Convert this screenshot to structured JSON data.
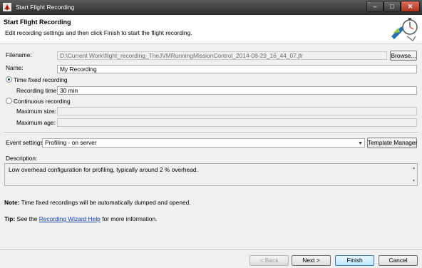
{
  "window": {
    "title": "Start Flight Recording",
    "minimize_label": "‒",
    "maximize_label": "□",
    "close_label": "✕"
  },
  "header": {
    "title": "Start Flight Recording",
    "description": "Edit recording settings and then click Finish to start the flight recording."
  },
  "filename": {
    "label": "Filename:",
    "value": "D:\\Current Work\\flight_recording_TheJVMRunningMissionControl_2014-08-29_16_44_07.jfr",
    "browse_label": "Browse..."
  },
  "name": {
    "label": "Name:",
    "value": "My Recording"
  },
  "time_fixed": {
    "label": "Time fixed recording",
    "selected": true,
    "recording_time_label": "Recording time:",
    "recording_time_value": "30 min"
  },
  "continuous": {
    "label": "Continuous recording",
    "selected": false,
    "max_size_label": "Maximum size:",
    "max_size_value": "",
    "max_age_label": "Maximum age:",
    "max_age_value": ""
  },
  "event_settings": {
    "label": "Event settings:",
    "selected": "Profiling - on server",
    "template_manager_label": "Template Manager"
  },
  "description": {
    "label": "Description:",
    "text": "Low overhead configuration for profiling, typically around 2 % overhead."
  },
  "note": {
    "prefix": "Note:",
    "text": "Time fixed recordings will be automatically dumped and opened."
  },
  "tip": {
    "prefix": "Tip:",
    "before": "See the",
    "link": "Recording Wizard Help",
    "after": "for more information."
  },
  "footer": {
    "back_label": "< Back",
    "next_label": "Next >",
    "finish_label": "Finish",
    "cancel_label": "Cancel"
  },
  "colors": {
    "titlebar": "#2b2b2b",
    "close_button": "#c8432e",
    "link": "#1a41a8"
  }
}
